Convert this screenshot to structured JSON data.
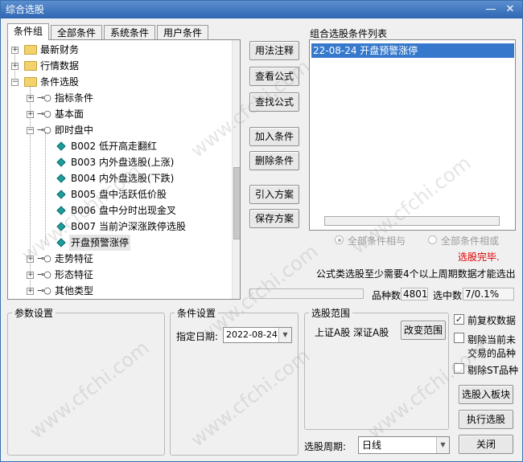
{
  "window": {
    "title": "综合选股",
    "minimize_glyph": "—",
    "close_glyph": "✕"
  },
  "tabs": [
    {
      "label": "条件组",
      "active": true
    },
    {
      "label": "全部条件",
      "active": false
    },
    {
      "label": "系统条件",
      "active": false
    },
    {
      "label": "用户条件",
      "active": false
    }
  ],
  "tree": {
    "folders": [
      {
        "label": "最新财务",
        "expander": "+"
      },
      {
        "label": "行情数据",
        "expander": "+"
      },
      {
        "label": "条件选股",
        "expander": "−"
      }
    ],
    "groups_top": [
      {
        "label": "指标条件",
        "expander": "+"
      },
      {
        "label": "基本面",
        "expander": "+"
      },
      {
        "label": "即时盘中",
        "expander": "−"
      }
    ],
    "leaves": [
      {
        "label": "B002 低开高走翻红"
      },
      {
        "label": "B003 内外盘选股(上涨)"
      },
      {
        "label": "B004 内外盘选股(下跌)"
      },
      {
        "label": "B005 盘中活跃低价股"
      },
      {
        "label": "B006 盘中分时出现金叉"
      },
      {
        "label": "B007 当前沪深涨跌停选股"
      },
      {
        "label": "开盘预警涨停"
      }
    ],
    "groups_bottom": [
      {
        "label": "走势特征",
        "expander": "+"
      },
      {
        "label": "形态特征",
        "expander": "+"
      },
      {
        "label": "其他类型",
        "expander": "+"
      }
    ],
    "key_glyph": "⊸○"
  },
  "middle_buttons": {
    "usage_note": "用法注释",
    "view_formula": "查看公式",
    "find_formula": "找公式",
    "find_formula_full": "查找公式",
    "add_condition": "加入条件",
    "delete_condition": "删除条件",
    "import_plan": "引入方案",
    "save_plan": "保存方案"
  },
  "condition_list": {
    "title": "组合选股条件列表",
    "items": [
      "22-08-24 开盘预警涨停"
    ]
  },
  "logic": {
    "and_label": "全部条件相与",
    "or_label": "全部条件相或"
  },
  "status": {
    "done": "选股完毕.",
    "note": "公式类选股至少需要4个以上周期数据才能选出",
    "variety_label": "品种数",
    "variety_value": "4801",
    "selected_label": "选中数",
    "selected_value": "7/0.1%"
  },
  "params": {
    "title": "参数设置"
  },
  "conditions": {
    "title": "条件设置",
    "date_label": "指定日期:",
    "date_value": "2022-08-24"
  },
  "scope": {
    "title": "选股范围",
    "text": "上证A股 深证A股",
    "change_button": "改变范围"
  },
  "options": {
    "pre_adjust": {
      "label": "前复权数据",
      "checked": true
    },
    "exclude_untraded_line1": "剔除当前未",
    "exclude_untraded_line2": "交易的品种",
    "exclude_untraded_checked": false,
    "exclude_st": {
      "label": "剔除ST品种",
      "checked": false
    },
    "check_glyph": "✓"
  },
  "actions": {
    "to_block": "选股入板块",
    "run": "执行选股",
    "close": "关闭"
  },
  "period": {
    "label": "选股周期:",
    "value": "日线"
  },
  "watermark": "www.cfchi.com",
  "colors": {
    "title_bar": "#2f66b3",
    "selection": "#3679cc",
    "status_red": "#e00000"
  }
}
